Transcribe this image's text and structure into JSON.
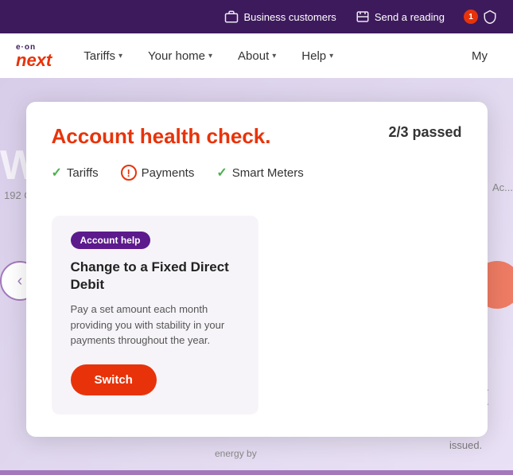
{
  "topbar": {
    "business_customers_label": "Business customers",
    "send_reading_label": "Send a reading",
    "notification_count": "1"
  },
  "navbar": {
    "logo_eon": "e·on",
    "logo_next": "next",
    "tariffs_label": "Tariffs",
    "your_home_label": "Your home",
    "about_label": "About",
    "help_label": "Help",
    "my_label": "My"
  },
  "modal": {
    "title": "Account health check.",
    "score": "2/3 passed",
    "checks": [
      {
        "label": "Tariffs",
        "status": "pass"
      },
      {
        "label": "Payments",
        "status": "warn"
      },
      {
        "label": "Smart Meters",
        "status": "pass"
      }
    ]
  },
  "card": {
    "badge": "Account help",
    "title": "Change to a Fixed Direct Debit",
    "description": "Pay a set amount each month providing you with stability in your payments throughout the year.",
    "button_label": "Switch"
  },
  "background": {
    "address": "192 G...",
    "energy_text": "energy by"
  }
}
